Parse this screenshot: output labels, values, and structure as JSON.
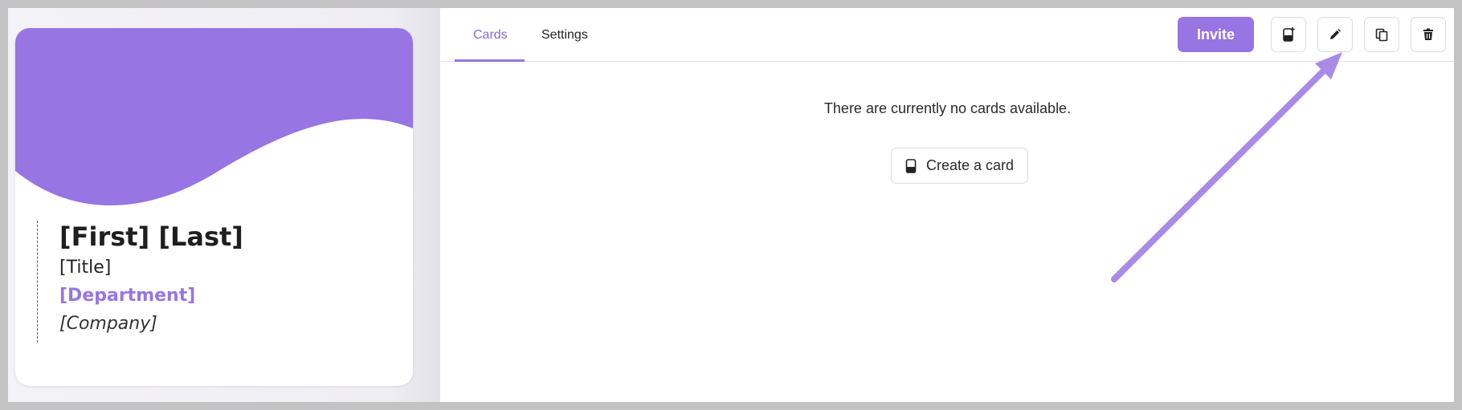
{
  "preview_card": {
    "name": "[First] [Last]",
    "title": "[Title]",
    "department": "[Department]",
    "company": "[Company]",
    "accent_color": "#9775e3"
  },
  "tabs": [
    {
      "label": "Cards",
      "active": true
    },
    {
      "label": "Settings",
      "active": false
    }
  ],
  "toolbar": {
    "invite_label": "Invite",
    "icons": [
      "new-card-icon",
      "pencil-icon",
      "copy-icon",
      "trash-icon"
    ]
  },
  "empty_state": {
    "message": "There are currently no cards available.",
    "create_label": "Create a card",
    "create_icon": "phone-icon"
  },
  "annotation": {
    "arrow_color": "#a98ae6",
    "points_to": "copy-icon"
  }
}
